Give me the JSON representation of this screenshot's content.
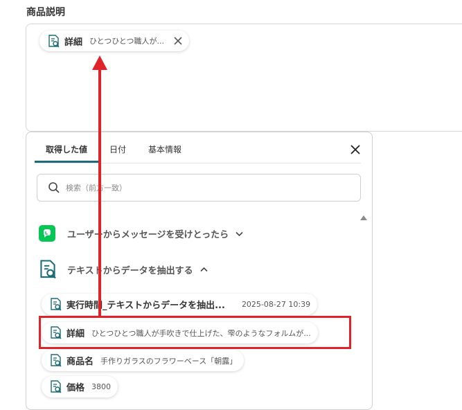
{
  "field": {
    "label": "商品説明"
  },
  "selected_chip": {
    "name": "詳細",
    "value": "ひとつひとつ職人が..."
  },
  "panel": {
    "tabs": [
      {
        "label": "取得した値",
        "active": true
      },
      {
        "label": "日付",
        "active": false
      },
      {
        "label": "基本情報",
        "active": false
      }
    ],
    "search_placeholder": "検索（前方一致）",
    "sections": [
      {
        "label": "ユーザーからメッセージを受けとったら",
        "icon": "line-icon",
        "expanded": false
      },
      {
        "label": "テキストからデータを抽出する",
        "icon": "doc-search-icon",
        "expanded": true
      }
    ],
    "items": [
      {
        "name": "実行時間_テキストからデータを抽出...",
        "value": "2025-08-27 10:39"
      },
      {
        "name": "詳細",
        "value": "ひとつひとつ職人が手吹きで仕上げた、雫のようなフォルムが..."
      },
      {
        "name": "商品名",
        "value": "手作りガラスのフラワーベース「朝露」"
      },
      {
        "name": "価格",
        "value": "3800"
      }
    ]
  },
  "colors": {
    "accent": "#1b6b78",
    "annotation": "#e0222a",
    "line_green": "#06c755"
  }
}
